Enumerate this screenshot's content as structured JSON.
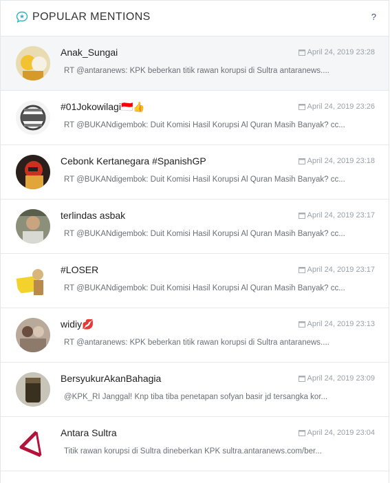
{
  "header": {
    "title": "POPULAR MENTIONS",
    "help": "?"
  },
  "mentions": [
    {
      "name": "Anak_Sungai",
      "time": "April 24, 2019 23:28",
      "text": "RT @antaranews: KPK beberkan titik rawan korupsi di Sultra antaranews...."
    },
    {
      "name": "#01Jokowilagi🇮🇩👍",
      "time": "April 24, 2019 23:26",
      "text": "RT @BUKANdigembok: Duit Komisi Hasil Korupsi Al Quran Masih Banyak? cc..."
    },
    {
      "name": "Cebonk Kertanegara #SpanishGP",
      "time": "April 24, 2019 23:18",
      "text": "RT @BUKANdigembok: Duit Komisi Hasil Korupsi Al Quran Masih Banyak? cc..."
    },
    {
      "name": "terlindas asbak",
      "time": "April 24, 2019 23:17",
      "text": "RT @BUKANdigembok: Duit Komisi Hasil Korupsi Al Quran Masih Banyak? cc..."
    },
    {
      "name": "#LOSER",
      "time": "April 24, 2019 23:17",
      "text": "RT @BUKANdigembok: Duit Komisi Hasil Korupsi Al Quran Masih Banyak? cc..."
    },
    {
      "name": "widiy💋",
      "time": "April 24, 2019 23:13",
      "text": "RT @antaranews: KPK beberkan titik rawan korupsi di Sultra antaranews...."
    },
    {
      "name": "BersyukurAkanBahagia",
      "time": "April 24, 2019 23:09",
      "text": "@KPK_RI Janggal! Knp tiba tiba penetapan sofyan basir jd tersangka kor..."
    },
    {
      "name": "Antara Sultra",
      "time": "April 24, 2019 23:04",
      "text": "Titik rawan korupsi di Sultra dineberkan KPK sultra.antaranews.com/ber..."
    }
  ]
}
